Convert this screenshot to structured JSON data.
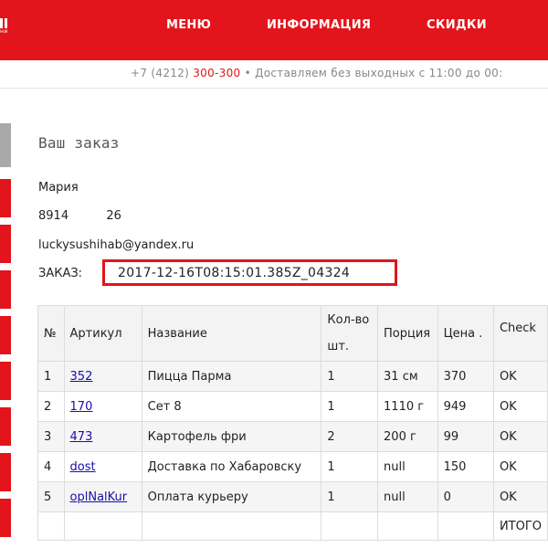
{
  "header": {
    "logo_sub": "ни",
    "nav": [
      "МЕНЮ",
      "ИНФОРМАЦИЯ",
      "СКИДКИ"
    ]
  },
  "contact": {
    "prefix": "+7 (4212) ",
    "phone": "300-300",
    "suffix": " • Доставляем без выходных с 11:00 до 00:"
  },
  "order": {
    "title": "Ваш заказ",
    "name": "Мария",
    "phone": "8914          26",
    "email": "luckysushihab@yandex.ru",
    "order_label": "ЗАКАЗ:",
    "order_id": "2017-12-16T08:15:01.385Z_04324"
  },
  "table": {
    "headers": [
      "№",
      "Артикул",
      "Название",
      "Кол-во шт.",
      "Порция",
      "Цена .",
      "Check"
    ],
    "rows": [
      {
        "n": "1",
        "sku": "352",
        "name": "Пицца Парма",
        "qty": "1",
        "portion": "31 см",
        "price": "370",
        "check": "OK"
      },
      {
        "n": "2",
        "sku": "170",
        "name": "Сет 8",
        "qty": "1",
        "portion": "1110 г",
        "price": "949",
        "check": "OK"
      },
      {
        "n": "3",
        "sku": "473",
        "name": "Картофель фри",
        "qty": "2",
        "portion": "200 г",
        "price": "99",
        "check": "OK"
      },
      {
        "n": "4",
        "sku": "dost",
        "name": "Доставка по Хабаровску",
        "qty": "1",
        "portion": "null",
        "price": "150",
        "check": "OK"
      },
      {
        "n": "5",
        "sku": "oplNalKur",
        "name": "Оплата курьеру",
        "qty": "1",
        "portion": "null",
        "price": "0",
        "check": "OK"
      }
    ],
    "total_label": "ИТОГО"
  },
  "colors": {
    "brand_red": "#e3141b",
    "link": "#1a0dab"
  }
}
